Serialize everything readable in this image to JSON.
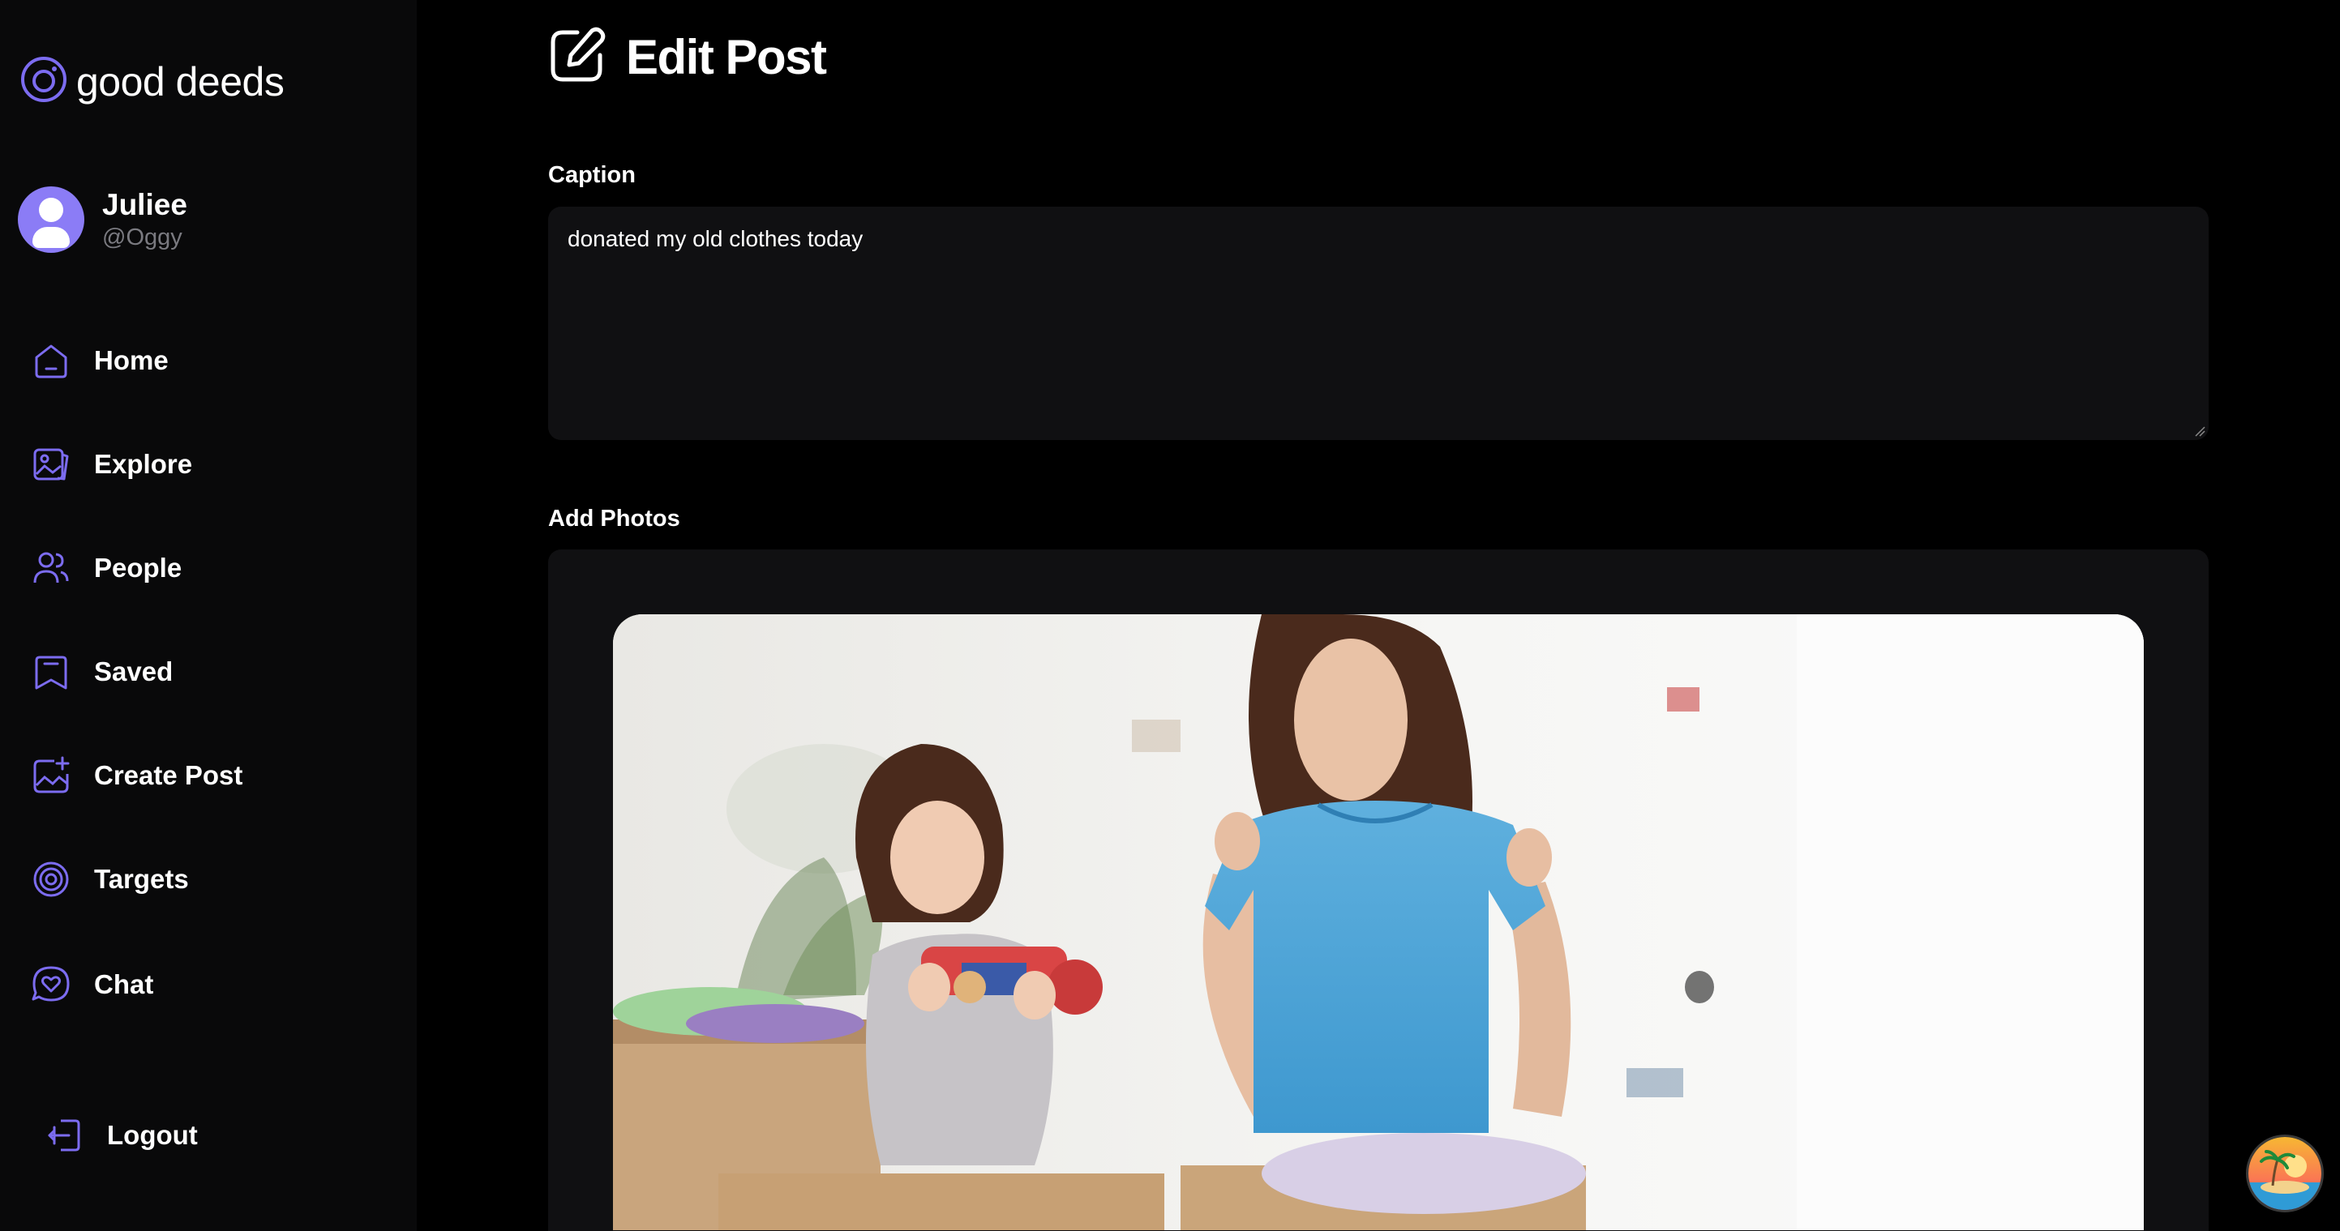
{
  "brand": {
    "name": "good deeds",
    "accent_color": "#7c6cf0"
  },
  "profile": {
    "name": "Juliee",
    "handle": "@Oggy"
  },
  "nav": [
    {
      "label": "Home",
      "icon": "home-icon"
    },
    {
      "label": "Explore",
      "icon": "gallery-icon"
    },
    {
      "label": "People",
      "icon": "people-icon"
    },
    {
      "label": "Saved",
      "icon": "bookmark-icon"
    },
    {
      "label": "Create Post",
      "icon": "add-image-icon"
    },
    {
      "label": "Targets",
      "icon": "target-icon"
    },
    {
      "label": "Chat",
      "icon": "chat-heart-icon"
    },
    {
      "label": "Logout",
      "icon": "logout-icon"
    }
  ],
  "page": {
    "title": "Edit Post",
    "title_icon": "edit-icon"
  },
  "form": {
    "caption_label": "Caption",
    "caption_value": "donated my old clothes today",
    "photos_label": "Add Photos",
    "photo_description_icon": "uploaded-photo"
  },
  "colors": {
    "background": "#000000",
    "sidebar": "#09090a",
    "panel": "#101012",
    "accent": "#7c6cf0",
    "muted_text": "#7a7a80"
  }
}
